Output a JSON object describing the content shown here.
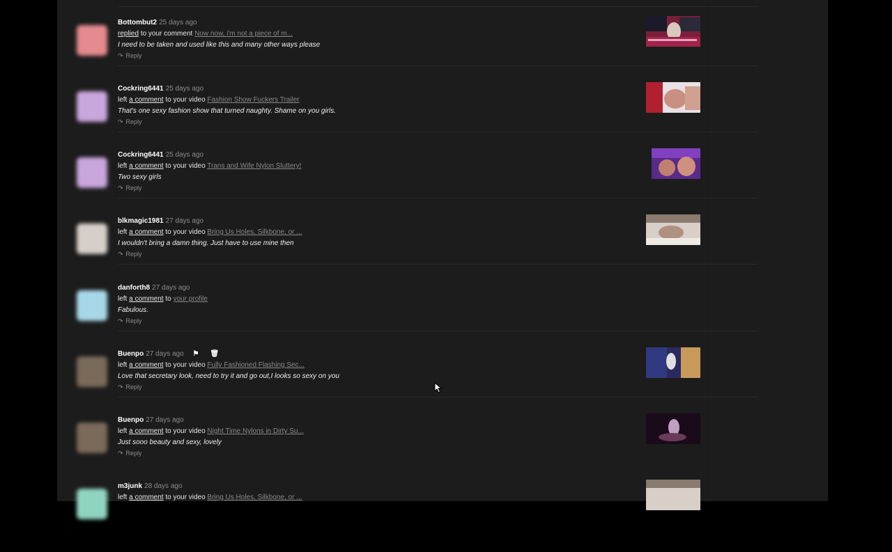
{
  "comments": [
    {
      "username": "Bottombut2",
      "time": "25 days ago",
      "action_link": "replied",
      "action_text": "to your comment",
      "target": "Now now, i'm not a piece of m...",
      "text": "I need to be taken and used like this and many other ways please",
      "reply_label": "Reply",
      "avatar_color": "#e58a8f",
      "has_thumb": true
    },
    {
      "username": "Cockring6441",
      "time": "25 days ago",
      "action_prefix": "left",
      "action_link": "a comment",
      "action_text": "to your video",
      "target": "Fashion Show Fuckers Trailer",
      "text": "That's one sexy fashion show that turned naughty. Shame on you girls.",
      "reply_label": "Reply",
      "avatar_color": "#c9a6dc",
      "has_thumb": true
    },
    {
      "username": "Cockring6441",
      "time": "25 days ago",
      "action_prefix": "left",
      "action_link": "a comment",
      "action_text": "to your video",
      "target": "Trans and Wife Nylon Sluttery!",
      "text": "Two sexy girls",
      "reply_label": "Reply",
      "avatar_color": "#c9a6dc",
      "has_thumb": true
    },
    {
      "username": "blkmagic1981",
      "time": "27 days ago",
      "action_prefix": "left",
      "action_link": "a comment",
      "action_text": "to your video",
      "target": "Bring Us Holes, Silkbone, or ...",
      "text": "I wouldn't bring a damn thing.  Just have to use mine then",
      "reply_label": "Reply",
      "avatar_color": "#d6cfc9",
      "has_thumb": true
    },
    {
      "username": "danforth8",
      "time": "27 days ago",
      "action_prefix": "left",
      "action_link": "a comment",
      "action_text": "to",
      "target": "your profile",
      "text": "Fabulous.",
      "reply_label": "Reply",
      "avatar_color": "#a8d8e8",
      "has_thumb": false
    },
    {
      "username": "Buenpo",
      "time": "27 days ago",
      "action_prefix": "left",
      "action_link": "a comment",
      "action_text": "to your video",
      "target": "Fully Fashioned Flashing Sec...",
      "text": "Love that secretary look, need to try it and go out,I looks so sexy on you",
      "reply_label": "Reply",
      "avatar_color": "#7a6a5a",
      "has_thumb": true,
      "show_icons": true
    },
    {
      "username": "Buenpo",
      "time": "27 days ago",
      "action_prefix": "left",
      "action_link": "a comment",
      "action_text": "to your video",
      "target": "Night Time Nylons in Dirty Su...",
      "text": "Just sooo beauty and sexy, lovely",
      "reply_label": "Reply",
      "avatar_color": "#7a6a5a",
      "has_thumb": true
    },
    {
      "username": "m3junk",
      "time": "28 days ago",
      "action_prefix": "left",
      "action_link": "a comment",
      "action_text": "to your video",
      "target": "Bring Us Holes, Silkbone, or ...",
      "text": "",
      "reply_label": "",
      "avatar_color": "#8fd4c0",
      "has_thumb": true
    }
  ],
  "icons": {
    "reply": "reply-arrow-icon",
    "flag": "flag-icon",
    "delete": "trash-icon"
  }
}
